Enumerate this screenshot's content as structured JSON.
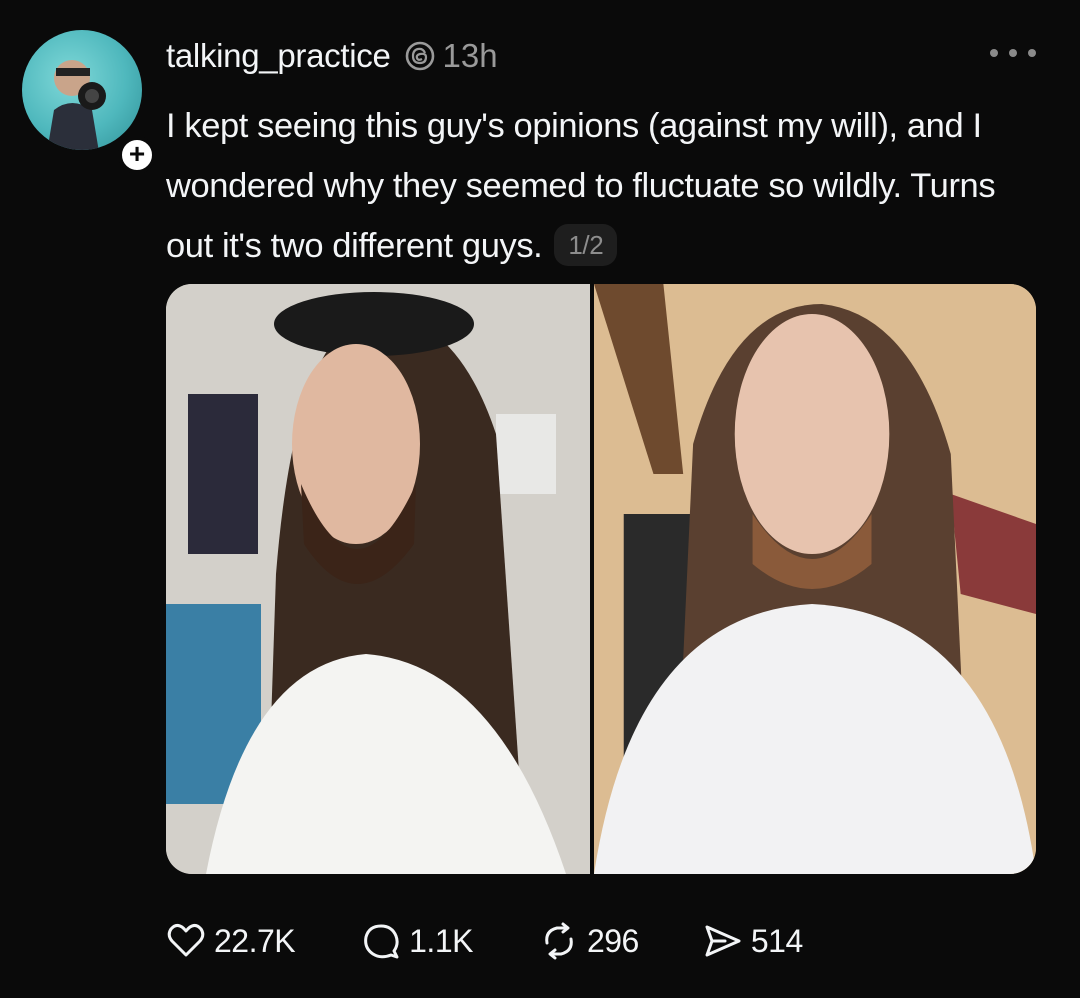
{
  "post": {
    "username": "talking_practice",
    "time": "13h",
    "text": "I kept seeing this guy's opinions (against my will), and I wondered why they seemed to fluctuate so wildly. Turns out it's two different guys.",
    "image_counter": "1/2"
  },
  "follow_badge": "+",
  "icons": {
    "verified": "threads-icon",
    "more": "more-icon",
    "like": "heart-icon",
    "reply": "comment-icon",
    "repost": "repost-icon",
    "share": "share-icon"
  },
  "actions": {
    "likes": "22.7K",
    "replies": "1.1K",
    "reposts": "296",
    "shares": "514"
  },
  "colors": {
    "background": "#0a0a0a",
    "text": "#f3f5f7",
    "muted": "#9a9a9a",
    "counter_bg": "#1e1e1e"
  }
}
